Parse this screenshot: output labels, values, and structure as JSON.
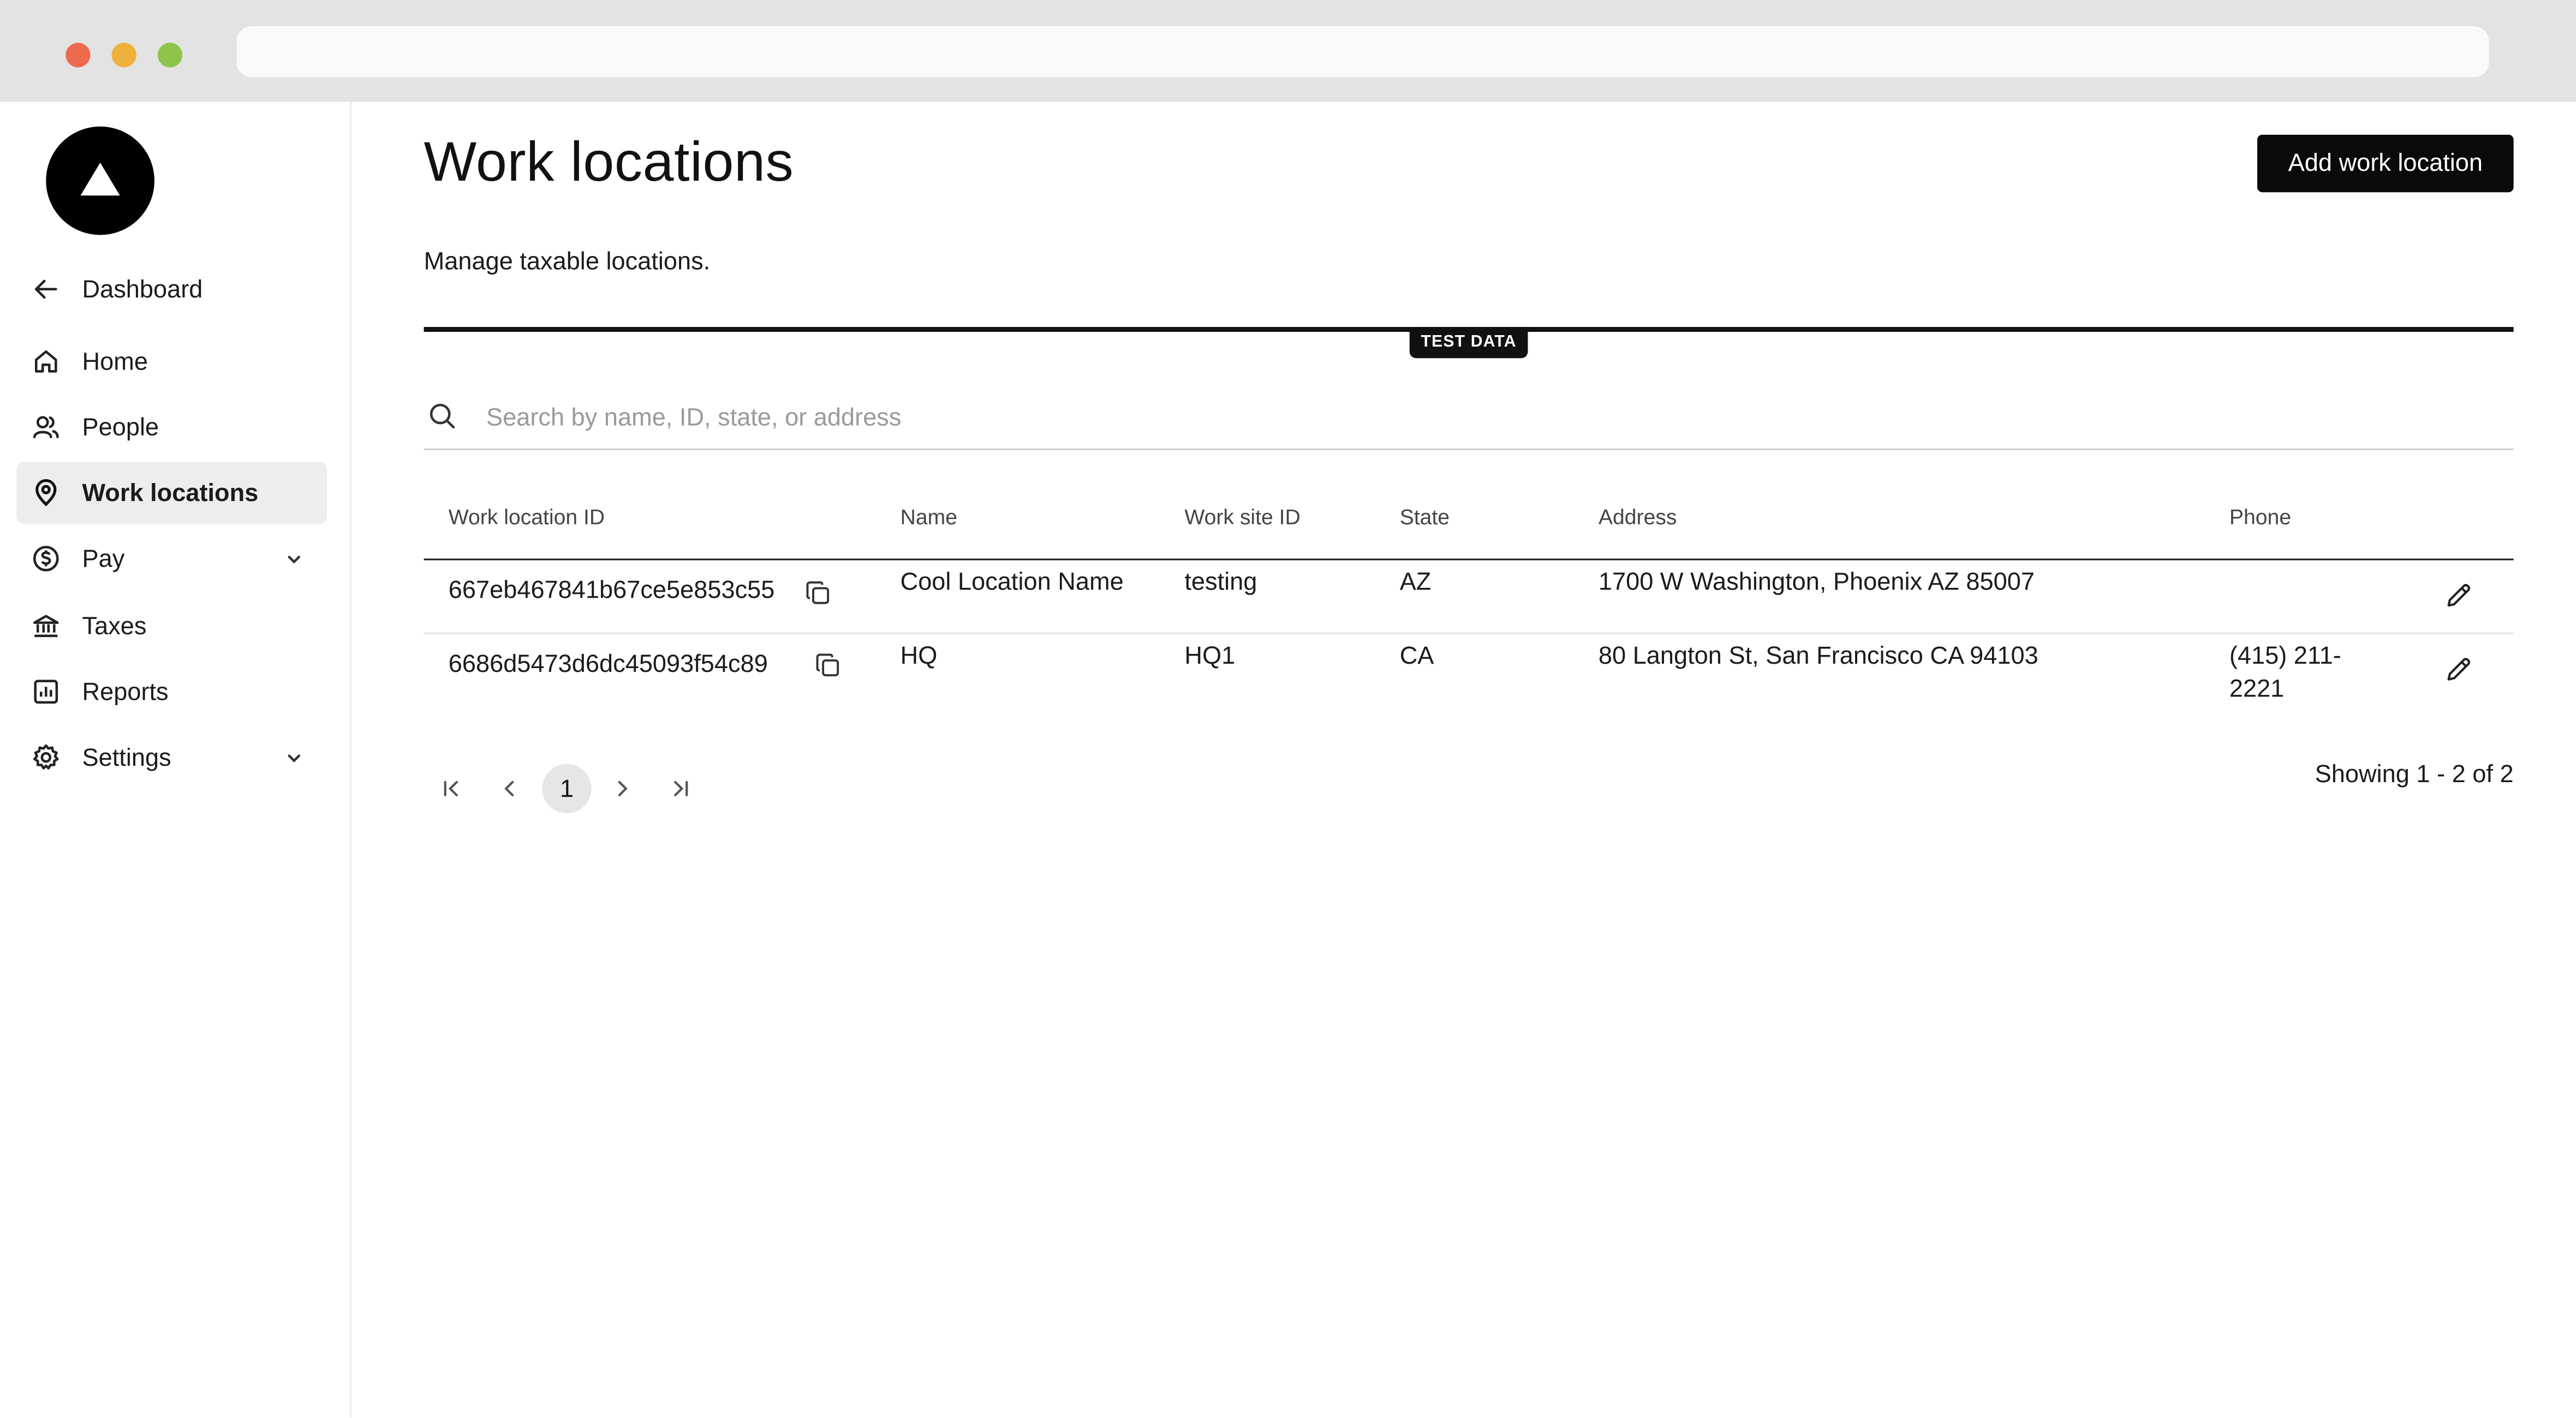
{
  "page": {
    "title": "Work locations",
    "subtitle": "Manage taxable locations.",
    "add_button": "Add work location",
    "badge": "TEST DATA"
  },
  "sidebar": {
    "items": [
      {
        "label": "Dashboard",
        "icon": "arrow-left-icon"
      },
      {
        "label": "Home",
        "icon": "home-icon"
      },
      {
        "label": "People",
        "icon": "people-icon"
      },
      {
        "label": "Work locations",
        "icon": "map-pin-icon",
        "active": true
      },
      {
        "label": "Pay",
        "icon": "dollar-circle-icon",
        "expandable": true
      },
      {
        "label": "Taxes",
        "icon": "bank-icon"
      },
      {
        "label": "Reports",
        "icon": "chart-icon"
      },
      {
        "label": "Settings",
        "icon": "gear-icon",
        "expandable": true
      }
    ]
  },
  "search": {
    "placeholder": "Search by name, ID, state, or address",
    "value": ""
  },
  "table": {
    "headers": [
      "Work location ID",
      "Name",
      "Work site ID",
      "State",
      "Address",
      "Phone"
    ],
    "rows": [
      {
        "id": "667eb467841b67ce5e853c55",
        "name": "Cool Location Name",
        "work_site_id": "testing",
        "state": "AZ",
        "address": "1700 W Washington, Phoenix AZ 85007",
        "phone_line1": "",
        "phone_line2": ""
      },
      {
        "id": "6686d5473d6dc45093f54c89",
        "name": "HQ",
        "work_site_id": "HQ1",
        "state": "CA",
        "address": "80 Langton St, San Francisco CA 94103",
        "phone_line1": "(415) 211-",
        "phone_line2": "2221"
      }
    ]
  },
  "pagination": {
    "current_page": "1",
    "showing": "Showing 1 - 2 of 2"
  },
  "colors": {
    "accent": "#0a0a0a",
    "active_nav_bg": "#ededed",
    "chrome_bg": "#e3e3e3"
  }
}
